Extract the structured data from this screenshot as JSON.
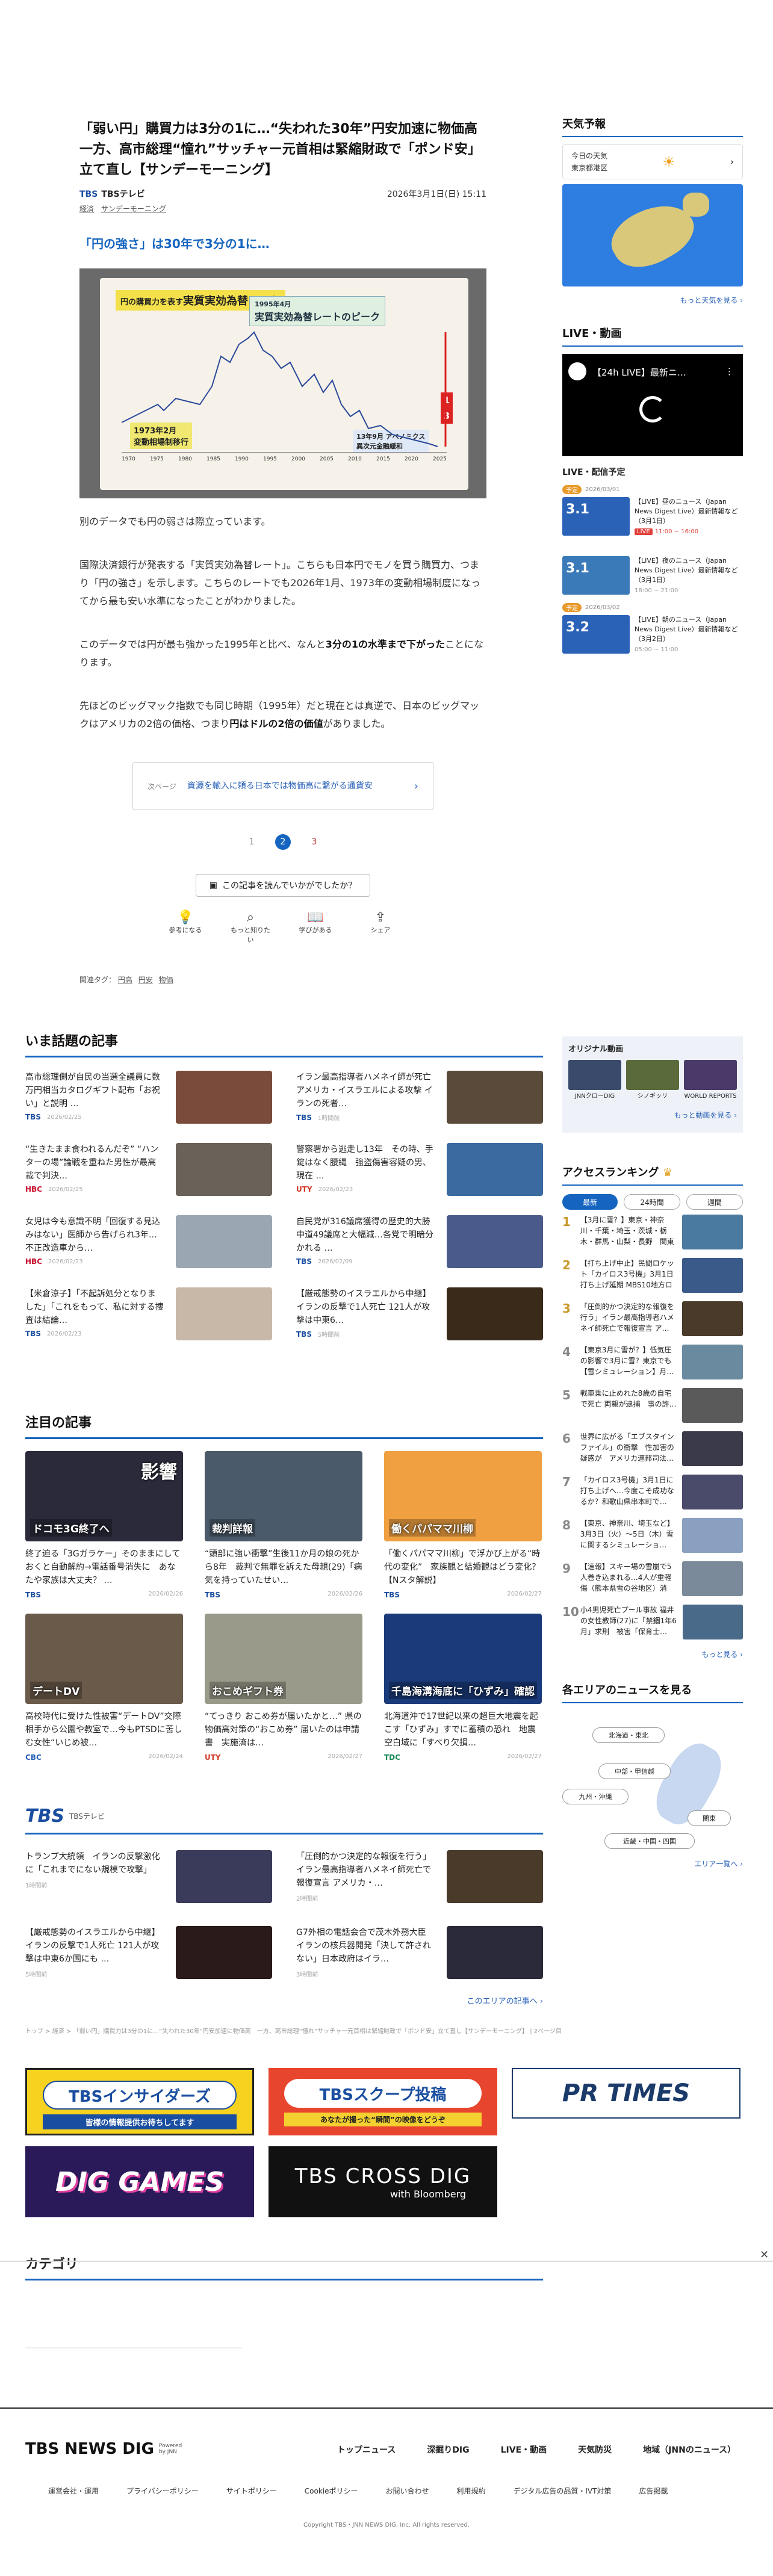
{
  "article": {
    "title": "「弱い円」購買力は3分の1に…“失われた30年”円安加速に物価高　一方、高市総理“憧れ”サッチャー元首相は緊縮財政で「ポンド安」立て直し【サンデーモーニング】",
    "source": "TBSテレビ",
    "source_logo": "TBS",
    "date": "2026年3月1日(日) 15:11",
    "categories": [
      "経済",
      "サンデーモーニング"
    ],
    "lead": "「円の強さ」は30年で3分の1に…",
    "hero": {
      "title1": "円の購買力を表す",
      "title2": "実質実効為替レート",
      "peak_label1": "実質実効為替レートのピーク",
      "peak_label2": "1995年4月",
      "low_label1": "1973年2月",
      "low_label2": "変動相場制移行",
      "now_label1": "13年9月 アベノミクス",
      "now_label2": "異次元金融緩和",
      "ratio_top": "1",
      "ratio_bottom": "3",
      "x_ticks": [
        "1970",
        "1975",
        "1980",
        "1985",
        "1990",
        "1995",
        "2000",
        "2005",
        "2010",
        "2015",
        "2020",
        "2025"
      ]
    },
    "paragraphs": [
      {
        "pre": "別のデータでも円の弱さは際立っています。",
        "bold": "",
        "post": ""
      },
      {
        "pre": "国際決済銀行が発表する「実質実効為替レート」。こちらも日本円でモノを買う購買力、つまり「円の強さ」を示します。こちらのレートでも2026年1月、1973年の変動相場制度になってから最も安い水準になったことがわかりました。",
        "bold": "",
        "post": ""
      },
      {
        "pre": "このデータでは円が最も強かった1995年と比べ、なんと",
        "bold": "3分の1の水準まで下がった",
        "post": "ことになります。"
      },
      {
        "pre": "先ほどのビッグマック指数でも同じ時期（1995年）だと現在とは真逆で、日本のビッグマックはアメリカの2倍の価格、つまり",
        "bold": "円はドルの2倍の価値",
        "post": "がありました。"
      }
    ],
    "next": {
      "label": "次ページ",
      "text": "資源を輸入に頼る日本では物価高に繋がる通貨安"
    },
    "pages": [
      "1",
      "2",
      "3"
    ],
    "current_page": "2",
    "reaction_prompt": "この記事を読んでいかがでしたか？",
    "reactions": [
      "参考になる",
      "もっと知りたい",
      "学びがある",
      "シェア"
    ],
    "tags_label": "関連タグ：",
    "tags": [
      "円高",
      "円安",
      "物価"
    ]
  },
  "trending": {
    "title": "いま話題の記事",
    "items": [
      {
        "text": "高市総理側が自民の当選全議員に数万円相当カタログギフト配布「お祝い」と説明 …",
        "src": "TBS",
        "date": "2026/02/25",
        "color": "#7a4a3a"
      },
      {
        "text": "イラン最高指導者ハメネイ師が死亡 アメリカ・イスラエルによる攻撃 イランの死者…",
        "src": "TBS",
        "date": "1時間前",
        "color": "#5a4a3a"
      },
      {
        "text": "“生きたまま食われるんだぞ” “ハンターの場”論戦を重ねた男性が最高裁で判決…",
        "src": "HBC",
        "date": "2026/02/25",
        "color": "#6a6258"
      },
      {
        "text": "警察署から逃走し13年　その時、手錠はなく腰縄　強盗傷害容疑の男、現在 …",
        "src": "UTY",
        "date": "2026/02/23",
        "color": "#3a6aa0"
      },
      {
        "text": "女児は今も意識不明「回復する見込みはない」医師から告げられ3年…不正改造車から…",
        "src": "HBC",
        "date": "2026/02/23",
        "color": "#9aa6b2"
      },
      {
        "text": "自民党が316議席獲得の歴史的大勝　中道49議席と大幅減…各党で明暗分かれる …",
        "src": "TBS",
        "date": "2026/02/09",
        "color": "#4a5a8a"
      },
      {
        "text": "【米倉涼子】「不起訴処分となりました」「これをもって、私に対する捜査は結論…",
        "src": "TBS",
        "date": "2026/02/23",
        "color": "#c8b8a8"
      },
      {
        "text": "【厳戒態勢のイスラエルから中継】イランの反撃で1人死亡 121人が攻撃は中東6…",
        "src": "TBS",
        "date": "5時間前",
        "color": "#3a2a1a"
      }
    ]
  },
  "featured": {
    "title": "注目の記事",
    "items": [
      {
        "text": "終了迫る「3Gガラケー」そのままにしておくと自動解約→電話番号消失に　あなたや家族は大丈夫？ …",
        "src": "TBS",
        "date": "2026/02/26",
        "color": "#2a2a3a",
        "label": "ドコモ3G終了へ",
        "label2": "影響"
      },
      {
        "text": "“頭部に強い衝撃”生後11か月の娘の死から8年　裁判で無罪を訴えた母親(29)「病気を持っていたせい…",
        "src": "TBS",
        "date": "2026/02/26",
        "color": "#4a5a6a",
        "label": "裁判詳報",
        "label2": ""
      },
      {
        "text": "「働くパパママ川柳」で浮かび上がる“時代の変化”　家族観と結婚観はどう変化？【Nスタ解説】",
        "src": "TBS",
        "date": "2026/02/27",
        "color": "#f0a040",
        "label": "働くパパママ川柳",
        "label2": ""
      },
      {
        "text": "高校時代に受けた性被害“デートDV”交際相手から公園や教室で…今もPTSDに苦しむ女性“いじめ被…",
        "src": "CBC",
        "date": "2026/02/24",
        "color": "#6a5a4a",
        "label": "デートDV",
        "label2": ""
      },
      {
        "text": "“てっきり おこめ券が届いたかと…” 県の物価高対策の“おこめ券” 届いたのは申請書　実施済は…",
        "src": "UTY",
        "date": "2026/02/27",
        "color": "#9a9a8a",
        "label": "おこめギフト券",
        "label2": ""
      },
      {
        "text": "北海道沖で17世紀以来の超巨大地震を起こす「ひずみ」すでに蓄積の恐れ　地震空白域に「すべり欠損…",
        "src": "TDC",
        "date": "2026/02/27",
        "color": "#1a3a7a",
        "label": "千島海溝海底に「ひずみ」確認",
        "label2": ""
      }
    ]
  },
  "tbs_block": {
    "logo": "TBS",
    "sub": "TBSテレビ",
    "items": [
      {
        "text": "トランプ大統領　イランの反撃激化に「これまでにない規模で攻撃」",
        "date": "1時間前",
        "color": "#3a3a5a"
      },
      {
        "text": "「圧倒的かつ決定的な報復を行う」イラン最高指導者ハメネイ師死亡で報復宣言 アメリカ・…",
        "date": "2時間前",
        "color": "#4a3a2a"
      },
      {
        "text": "【厳戒態勢のイスラエルから中継】イランの反撃で1人死亡 121人が攻撃は中東6か国にも …",
        "date": "5時間前",
        "color": "#2a1a1a"
      },
      {
        "text": "G7外相の電話会合で茂木外務大臣 イランの核兵器開発「決して許されない」日本政府はイラ…",
        "date": "3時間前",
        "color": "#2a2a3a"
      }
    ],
    "more": "このエリアの記事へ"
  },
  "breadcrumb": "トップ > 経済 > 「弱い円」購買力は3分の1に…“失われた30年”円安加速に物価高　一方、高市総理“憧れ”サッチャー元首相は緊縮財政で「ポンド安」立て直し【サンデーモーニング】 | 2ページ目",
  "banners": {
    "insiders": "TBSインサイダーズ",
    "insiders_sub": "皆様の情報提供お待ちしてます",
    "scoop": "TBSスクープ投稿",
    "scoop_sub": "あなたが撮った“瞬間”の映像をどうぞ",
    "prtimes": "PR TIMES",
    "diggames": "DIG GAMES",
    "crossdig": "TBS CROSS DIG",
    "crossdig_sub": "with Bloomberg"
  },
  "category_title": "カテゴリ",
  "footer": {
    "logo": "TBS NEWS DIG",
    "logo_sub": "Powered by JNN",
    "nav": [
      "トップニュース",
      "深掘りDIG",
      "LIVE・動画",
      "天気防災",
      "地域（JNNのニュース）"
    ],
    "links": [
      "運営会社・運用",
      "プライバシーポリシー",
      "サイトポリシー",
      "Cookieポリシー",
      "お問い合わせ",
      "利用規約",
      "デジタル広告の品質・IVT対策",
      "広告掲載"
    ],
    "copyright": "Copyright TBS・JNN NEWS DIG, Inc. All rights reserved."
  },
  "sidebar": {
    "weather_title": "天気予報",
    "weather_today": "今日の天気",
    "weather_place": "東京都港区",
    "weather_more": "もっと天気を見る",
    "live_title": "LIVE・動画",
    "live_channel": "【24h LIVE】最新ニ…",
    "schedule_title": "LIVE・配信予定",
    "schedule": [
      {
        "badge": "予定",
        "date": "2026/03/01",
        "date_big": "3.1",
        "title": "【LIVE】昼のニュース（Japan News Digest Live）最新情報など（3月1日）",
        "status": "LIVE",
        "time": "11:00 ~ 16:00"
      },
      {
        "badge": "",
        "date": "",
        "date_big": "3.1",
        "title": "【LIVE】夜のニュース（Japan News Digest Live）最新情報など（3月1日）",
        "status": "",
        "time": "18:00 ~ 21:00"
      },
      {
        "badge": "予定",
        "date": "2026/03/02",
        "date_big": "3.2",
        "title": "【LIVE】朝のニュース（Japan News Digest Live）最新情報など（3月2日）",
        "status": "",
        "time": "05:00 ~ 11:00"
      }
    ],
    "original_title": "オリジナル動画",
    "originals": [
      {
        "label": "JNNクローDIG",
        "color": "#3a4a6a"
      },
      {
        "label": "シノギッリ",
        "color": "#5a6a3a"
      },
      {
        "label": "WORLD REPORTS",
        "color": "#4a3a6a"
      }
    ],
    "original_more": "もっと動画を見る",
    "ranking_title": "アクセスランキング",
    "ranking_tabs": [
      "最新",
      "24時間",
      "週間"
    ],
    "ranking": [
      {
        "num": "1",
        "text": "【3月に雪？】東京・神奈川・千葉・埼玉・茨城・栃木・群馬・山梨・長野　関東エリア…",
        "color": "#4a7aa0"
      },
      {
        "num": "2",
        "text": "【打ち上げ中止】民間ロケット「カイロス3号機」3月1日打ち上げ延期 MBS10地方ロケ…",
        "color": "#3a5a8a"
      },
      {
        "num": "3",
        "text": "「圧倒的かつ決定的な報復を行う」イラン最高指導者ハメネイ師死亡で報復宣言 ア…",
        "color": "#4a3a2a"
      },
      {
        "num": "4",
        "text": "【東京3月に雪が？】低気圧の影響で3月に雪？東京でも【雪シミュレーション】月…",
        "color": "#6a8aa0"
      },
      {
        "num": "5",
        "text": "戦車乗に止めれた8歳の自宅で死亡 両親が逮捕　事の許…",
        "color": "#5a5a5a"
      },
      {
        "num": "6",
        "text": "世界に広がる「エブスタインファイル」の衝撃　性加害の疑惑が　アメリカ連邦司法…",
        "color": "#3a3a4a"
      },
      {
        "num": "7",
        "text": "「カイロス3号機」3月1日に打ち上げへ…今度こそ成功なるか？和歌山県串本町で…",
        "color": "#4a4a6a"
      },
      {
        "num": "8",
        "text": "【東京、神奈川、埼玉など】3月3日（火）～5日（木）雪に関するシミュレーショ…",
        "color": "#8aa0c0"
      },
      {
        "num": "9",
        "text": "【速報】スキー場の雪崩で5人巻き込まれる…4人が重軽傷（熊本県雪の谷地区）消防…",
        "color": "#7a8a9a"
      },
      {
        "num": "10",
        "text": "小4男児死亡プール事故 福井の女性教師(27)に「禁錮1年6月」求刑　被害「保育士…",
        "color": "#4a6a8a"
      }
    ],
    "ranking_more": "もっと見る",
    "area_title": "各エリアのニュースを見る",
    "areas": [
      "北海道・東北",
      "中部・甲信越",
      "九州・沖縄",
      "関東",
      "近畿・中国・四国"
    ],
    "area_more": "エリア一覧へ"
  }
}
